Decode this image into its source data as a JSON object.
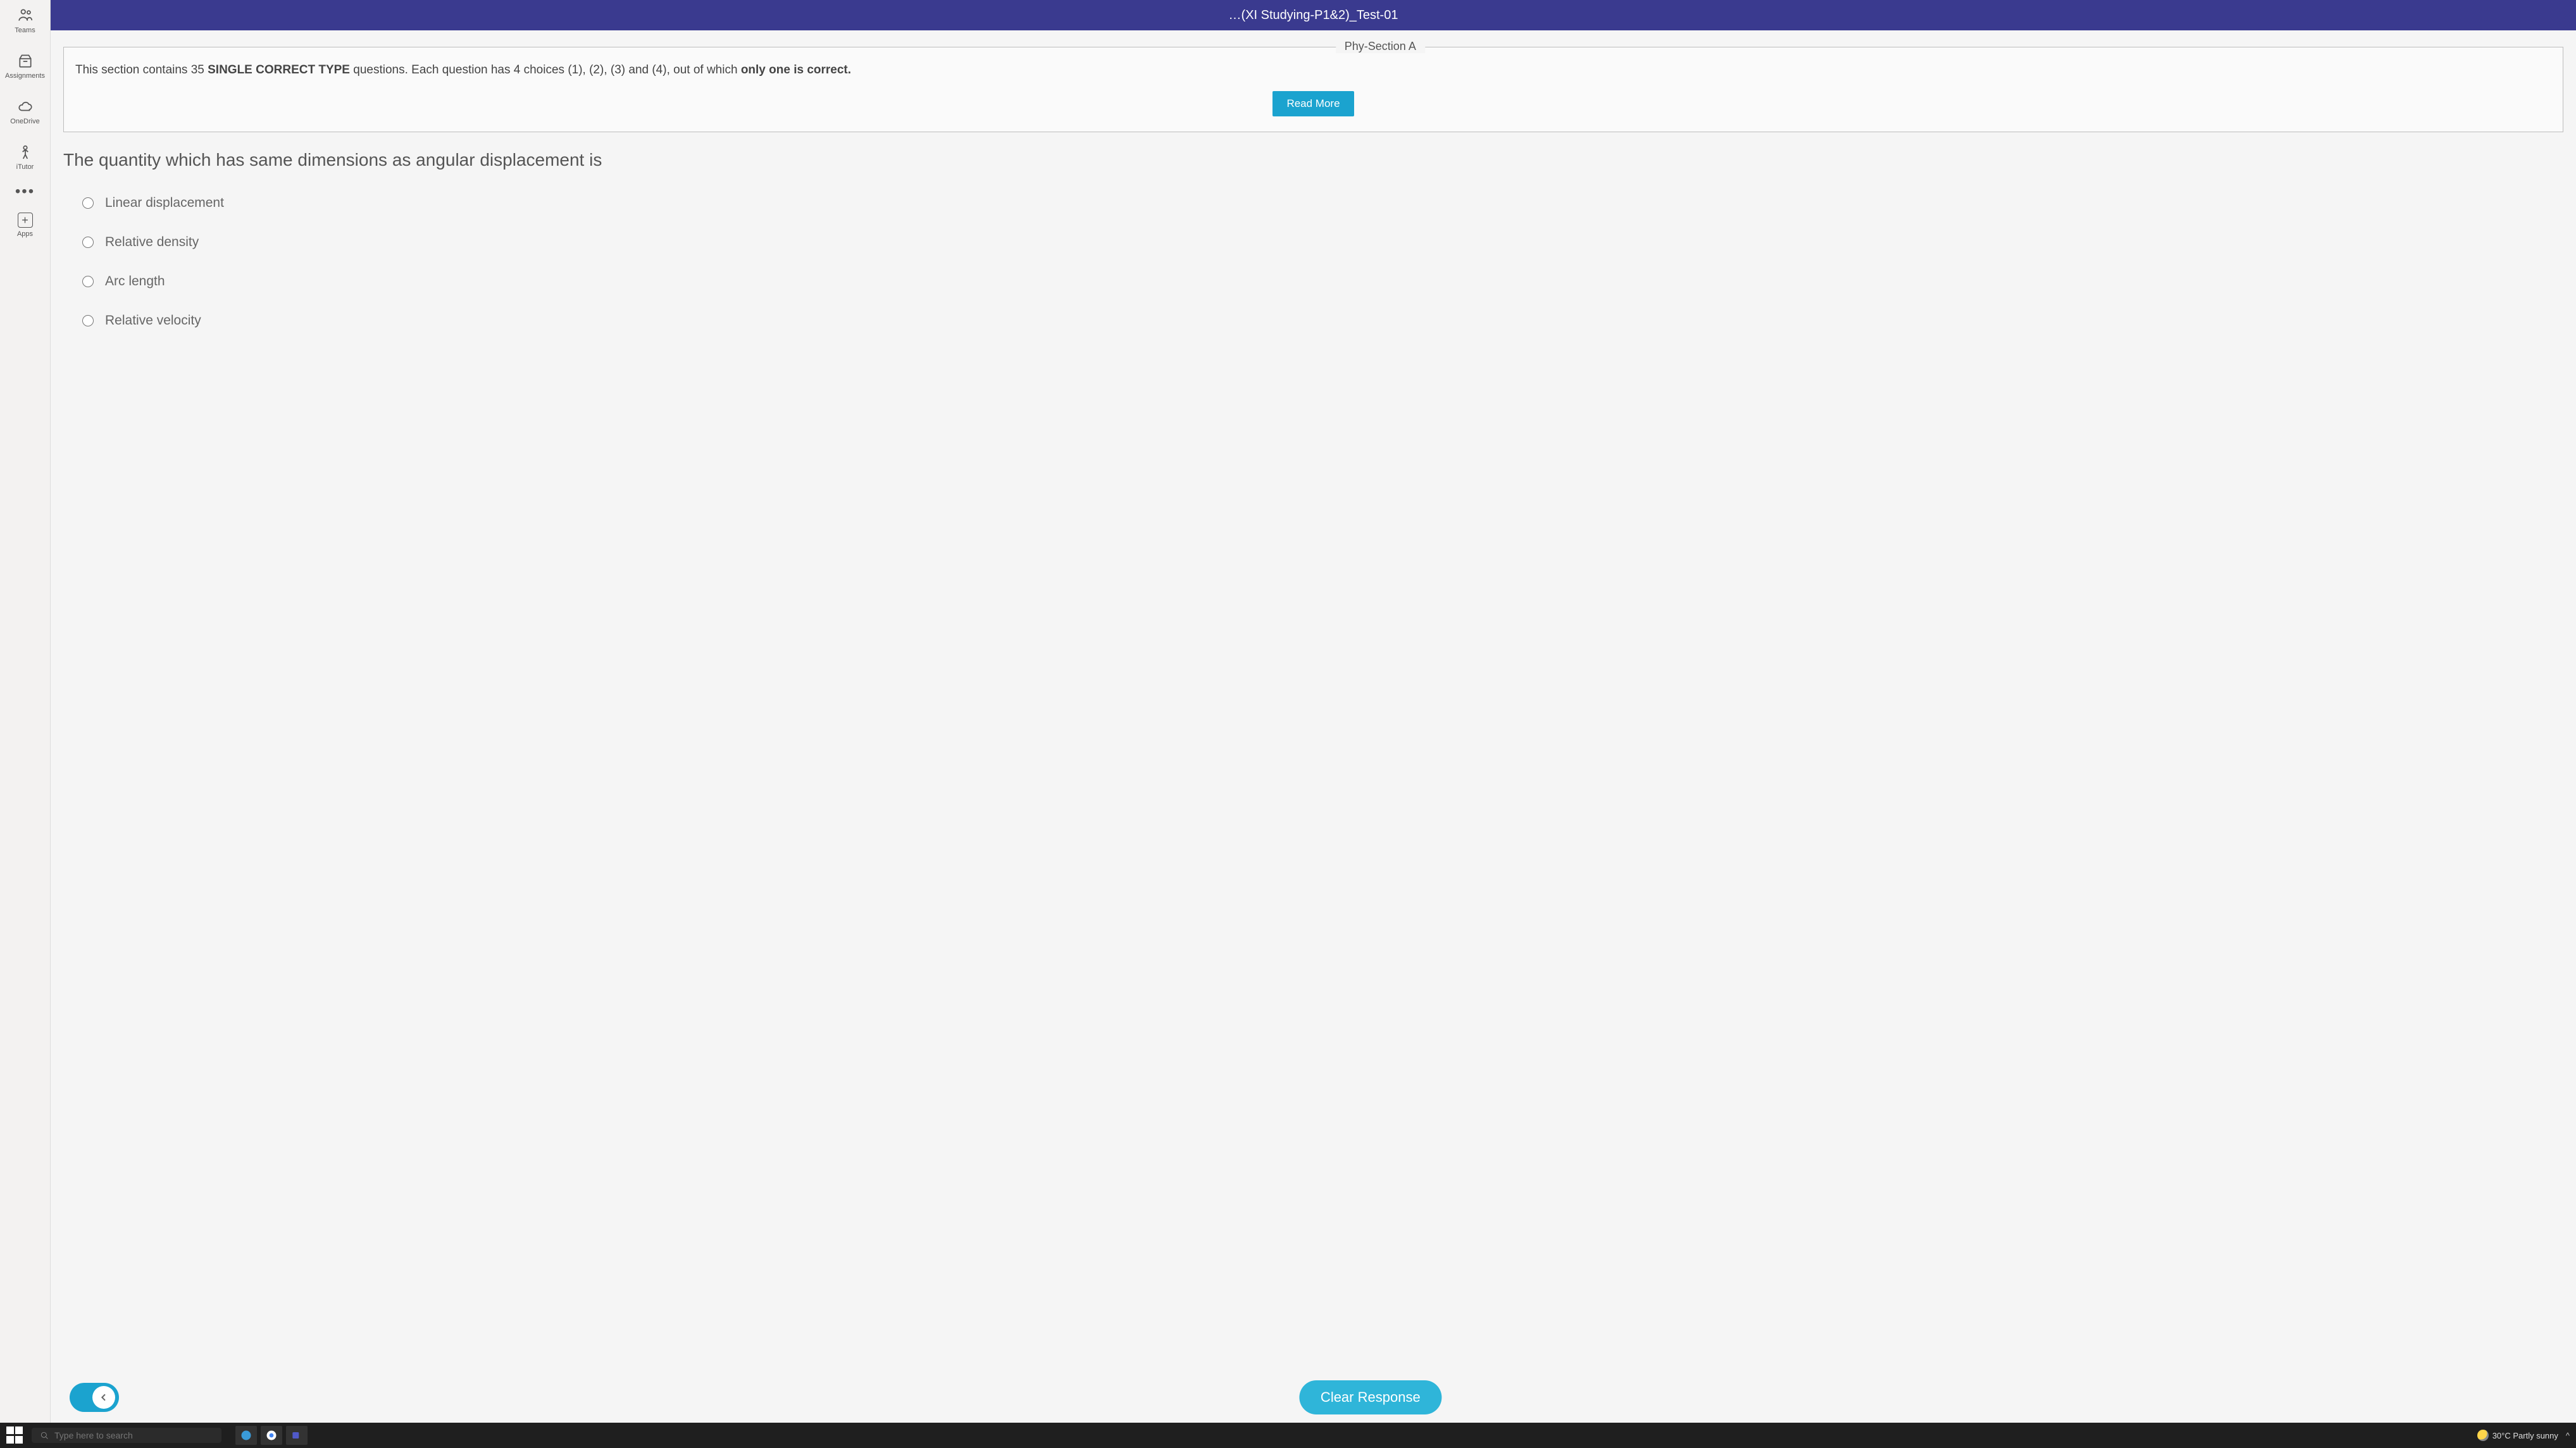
{
  "rail": {
    "teams": {
      "label": "Teams"
    },
    "assignments": {
      "label": "Assignments"
    },
    "onedrive": {
      "label": "OneDrive"
    },
    "itutor": {
      "label": "iTutor"
    },
    "apps": {
      "label": "Apps"
    }
  },
  "header": {
    "title": "…(XI Studying-P1&2)_Test-01"
  },
  "section": {
    "legend": "Phy-Section A",
    "text_prefix": "This section contains 35 ",
    "text_strong1": "SINGLE CORRECT TYPE",
    "text_mid": " questions. Each question has 4 choices (1), (2), (3) and (4), out of which ",
    "text_strong2": "only one is correct.",
    "readmore": "Read More"
  },
  "question": {
    "text": "The quantity which has same dimensions as angular displacement is",
    "options": [
      "Linear displacement",
      "Relative density",
      "Arc length",
      "Relative velocity"
    ]
  },
  "footer": {
    "clear": "Clear Response"
  },
  "taskbar": {
    "search_placeholder": "Type here to search",
    "weather": "30°C  Partly sunny",
    "tray": "^"
  }
}
